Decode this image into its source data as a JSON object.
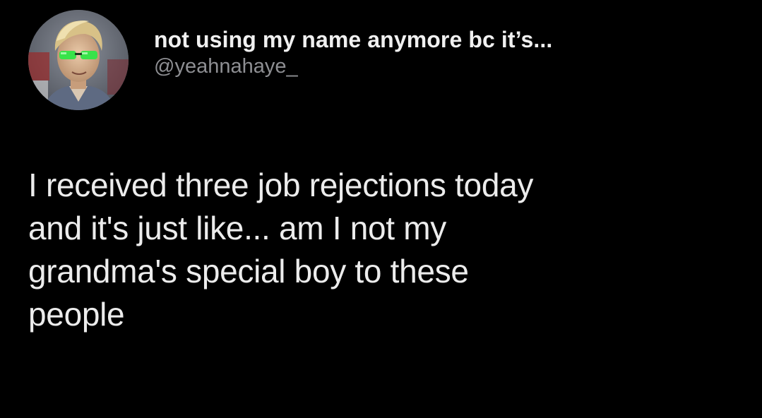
{
  "author": {
    "display_name": "not using my name anymore bc it’s...",
    "handle": "@yeahnahaye_",
    "avatar_icon": "profile-photo-green-sunglasses"
  },
  "tweet": {
    "text": "I received three job rejections today\nand it's just like... am I not my\ngrandma's special boy to these\npeople"
  },
  "colors": {
    "background": "#000000",
    "text": "#ececec",
    "handle": "#8e8f93",
    "sunglasses": "#39e34a"
  }
}
